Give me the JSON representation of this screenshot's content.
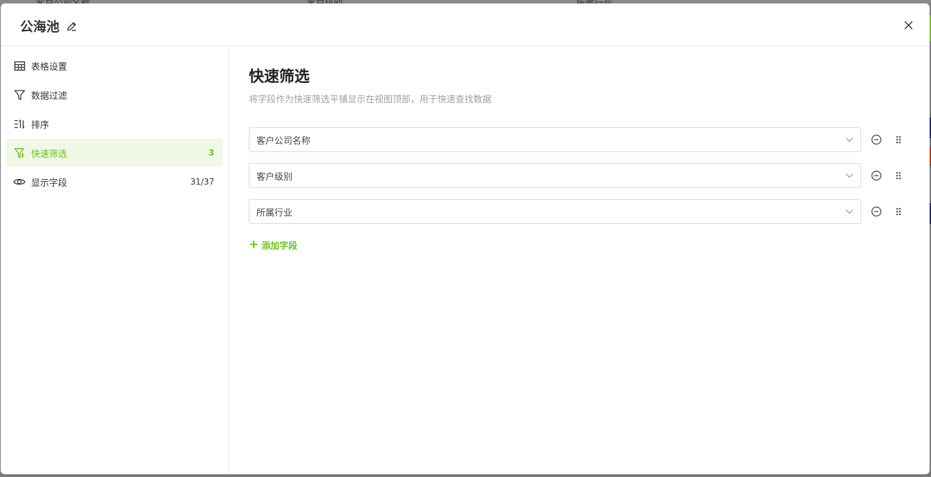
{
  "background": {
    "columns": [
      "客户公司名称",
      "客户级别",
      "所属行业"
    ]
  },
  "modal": {
    "title": "公海池",
    "edit_icon": "edit-icon",
    "close_icon": "close-icon"
  },
  "sidebar": {
    "items": [
      {
        "label": "表格设置",
        "icon": "table-icon",
        "count": ""
      },
      {
        "label": "数据过滤",
        "icon": "filter-icon",
        "count": ""
      },
      {
        "label": "排序",
        "icon": "sort-icon",
        "count": ""
      },
      {
        "label": "快速筛选",
        "icon": "quick-filter-icon",
        "count": "3",
        "active": true
      },
      {
        "label": "显示字段",
        "icon": "eye-icon",
        "count": "31/37"
      }
    ]
  },
  "main": {
    "title": "快速筛选",
    "description": "将字段作为快速筛选平铺显示在视图顶部，用于快速查找数据",
    "fields": [
      {
        "value": "客户公司名称"
      },
      {
        "value": "客户级别"
      },
      {
        "value": "所属行业"
      }
    ],
    "add_field_label": "添加字段"
  },
  "colors": {
    "accent": "#6fbf1f",
    "active_bg": "#f0f9e6"
  }
}
